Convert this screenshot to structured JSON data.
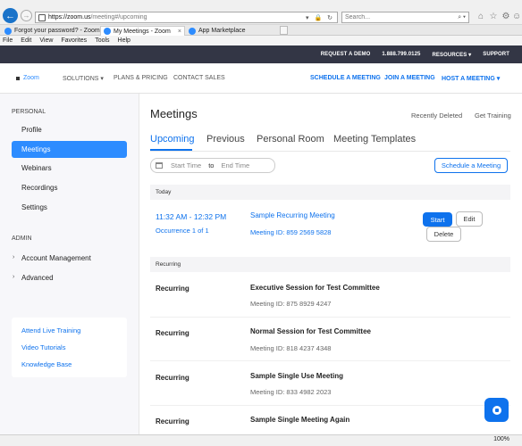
{
  "browser": {
    "url_main": "https://zoom.us",
    "url_rest": "/meeting#/upcoming",
    "search_placeholder": "Search...",
    "tabs": [
      {
        "label": "Forgot your password? - Zoom"
      },
      {
        "label": "My Meetings - Zoom"
      },
      {
        "label": "App Marketplace"
      }
    ],
    "menu": [
      "File",
      "Edit",
      "View",
      "Favorites",
      "Tools",
      "Help"
    ],
    "zoom_level": "100%"
  },
  "topbar": {
    "request_demo": "REQUEST A DEMO",
    "phone": "1.888.799.0125",
    "resources": "RESOURCES ▾",
    "support": "SUPPORT"
  },
  "nav": {
    "logo": "Zoom",
    "solutions": "SOLUTIONS ▾",
    "plans": "PLANS & PRICING",
    "contact": "CONTACT SALES",
    "schedule": "SCHEDULE A MEETING",
    "join": "JOIN A MEETING",
    "host": "HOST A MEETING ▾"
  },
  "sidebar": {
    "personal_heading": "PERSONAL",
    "items": [
      {
        "label": "Profile"
      },
      {
        "label": "Meetings"
      },
      {
        "label": "Webinars"
      },
      {
        "label": "Recordings"
      },
      {
        "label": "Settings"
      }
    ],
    "admin_heading": "ADMIN",
    "admin_items": [
      {
        "label": "Account Management"
      },
      {
        "label": "Advanced"
      }
    ],
    "help_links": [
      {
        "label": "Attend Live Training"
      },
      {
        "label": "Video Tutorials"
      },
      {
        "label": "Knowledge Base"
      }
    ]
  },
  "main": {
    "title": "Meetings",
    "recently_deleted": "Recently Deleted",
    "get_training": "Get Training",
    "tabs": [
      {
        "label": "Upcoming"
      },
      {
        "label": "Previous"
      },
      {
        "label": "Personal Room"
      },
      {
        "label": "Meeting Templates"
      }
    ],
    "start_time_placeholder": "Start Time",
    "to_label": "to",
    "end_time_placeholder": "End Time",
    "schedule_button": "Schedule a Meeting",
    "today_heading": "Today",
    "today_meeting": {
      "time": "11:32 AM - 12:32 PM",
      "occurrence": "Occurrence 1 of 1",
      "title": "Sample Recurring Meeting",
      "meeting_id": "Meeting ID: 859 2569 5828",
      "start_label": "Start",
      "edit_label": "Edit",
      "delete_label": "Delete"
    },
    "recurring_heading": "Recurring",
    "recurring": [
      {
        "label": "Recurring",
        "title": "Executive Session for Test Committee",
        "meeting_id": "Meeting ID: 875 8929 4247"
      },
      {
        "label": "Recurring",
        "title": "Normal Session for Test Committee",
        "meeting_id": "Meeting ID: 818 4237 4348"
      },
      {
        "label": "Recurring",
        "title": "Sample Single Use Meeting",
        "meeting_id": "Meeting ID: 833 4982 2023"
      },
      {
        "label": "Recurring",
        "title": "Sample Single Meeting Again",
        "meeting_id": ""
      }
    ]
  }
}
